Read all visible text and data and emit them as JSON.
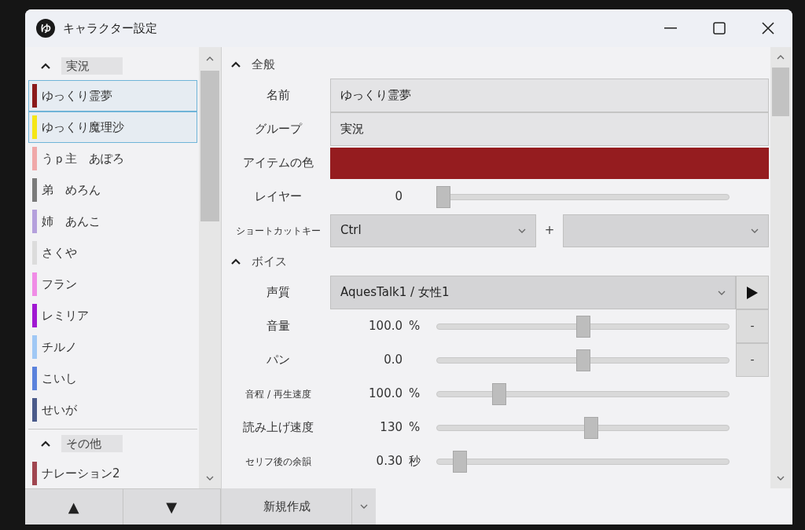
{
  "window": {
    "title": "キャラクター設定",
    "app_icon_text": "ゆ"
  },
  "character_groups": [
    {
      "label": "実況",
      "expanded": true,
      "items": [
        {
          "name": "ゆっくり霊夢",
          "color": "#8b1a1a",
          "selected": true
        },
        {
          "name": "ゆっくり魔理沙",
          "color": "#f5e616",
          "selected": true
        },
        {
          "name": "うｐ主　あぽろ",
          "color": "#f0a8a8",
          "selected": false
        },
        {
          "name": "弟　めろん",
          "color": "#7a7a7a",
          "selected": false
        },
        {
          "name": "姉　あんこ",
          "color": "#b4a0dc",
          "selected": false
        },
        {
          "name": "さくや",
          "color": "#dcdcdc",
          "selected": false
        },
        {
          "name": "フラン",
          "color": "#f08ce6",
          "selected": false
        },
        {
          "name": "レミリア",
          "color": "#a018d2",
          "selected": false
        },
        {
          "name": "チルノ",
          "color": "#a0c8f5",
          "selected": false
        },
        {
          "name": "こいし",
          "color": "#5a82dc",
          "selected": false
        },
        {
          "name": "せいが",
          "color": "#4a5a8a",
          "selected": false
        }
      ]
    },
    {
      "label": "その他",
      "expanded": true,
      "items": [
        {
          "name": "ナレーション2",
          "color": "#a04650",
          "selected": false
        }
      ]
    }
  ],
  "list_buttons": [
    "▲",
    "▼"
  ],
  "new_button": {
    "label": "新規作成"
  },
  "sections": [
    {
      "title": "全般",
      "expanded": true,
      "rows": [
        {
          "kind": "text",
          "label": "名前",
          "value": "ゆっくり霊夢"
        },
        {
          "kind": "text",
          "label": "グループ",
          "value": "実況"
        },
        {
          "kind": "color",
          "label": "アイテムの色",
          "color": "#951c1f"
        },
        {
          "kind": "slider",
          "label": "レイヤー",
          "reading": "0",
          "level": 0
        },
        {
          "kind": "shortcut",
          "label": "ショートカットキー",
          "value": "Ctrl",
          "joiner": "+",
          "small_label": true
        }
      ]
    },
    {
      "title": "ボイス",
      "expanded": true,
      "rows": [
        {
          "kind": "select",
          "label": "声質",
          "value": "AquesTalk1 / 女性1"
        },
        {
          "kind": "slider",
          "label": "音量",
          "reading": "100.0",
          "unit": "%",
          "level": 0.5,
          "side_button": "-"
        },
        {
          "kind": "slider",
          "label": "パン",
          "reading": "0.0",
          "level": 0.5,
          "side_button": "-"
        },
        {
          "kind": "slider",
          "label": "音程 / 再生速度",
          "reading": "100.0",
          "unit": "%",
          "level": 0.2,
          "small_label": true
        },
        {
          "kind": "slider",
          "label": "読み上げ速度",
          "reading": "130",
          "unit": "%",
          "level": 0.53
        },
        {
          "kind": "slider",
          "label": "セリフ後の余韻",
          "reading": "0.30",
          "unit": "秒",
          "level": 0.06,
          "small_label": true
        }
      ]
    }
  ]
}
